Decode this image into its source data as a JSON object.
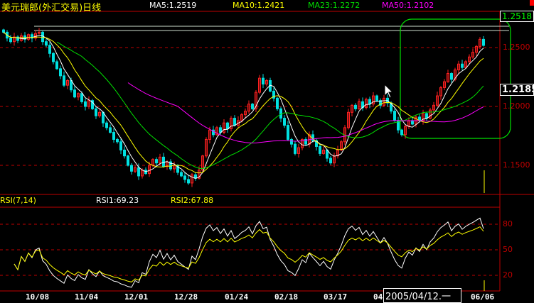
{
  "header": {
    "title": "美元瑞郎(外汇交易)日线",
    "ma5": "MA5:1.2519",
    "ma10": "MA10:1.2421",
    "ma23": "MA23:1.2272",
    "ma50": "MA50:1.2102"
  },
  "price_axis": {
    "labels": [
      "1.2500",
      "1.2000",
      "1.1500"
    ],
    "last_price": "1.2518",
    "cursor_price": "1.2185"
  },
  "rsi_panel": {
    "title": "RSI(7,14)",
    "rsi1": "RSI1:69.23",
    "rsi2": "RSI2:67.88",
    "levels": [
      "80",
      "50",
      "20"
    ]
  },
  "date_axis": {
    "labels": [
      "10/08",
      "11/04",
      "12/01",
      "12/28",
      "01/24",
      "02/18",
      "03/17",
      "04",
      "06/06"
    ],
    "cursor_date": "2005/04/12.一"
  },
  "colors": {
    "up": "#ff2020",
    "down": "#00e0e0",
    "ma5": "#ffffff",
    "ma10": "#ffff00",
    "ma23": "#00e000",
    "ma50": "#ff00ff",
    "grid": "#c00000"
  },
  "chart_data": {
    "type": "candlestick",
    "title": "美元瑞郎(外汇交易)日线",
    "ylim": [
      1.13,
      1.27
    ],
    "grid": true,
    "close": [
      1.263,
      1.258,
      1.255,
      1.259,
      1.256,
      1.26,
      1.257,
      1.261,
      1.258,
      1.262,
      1.263,
      1.255,
      1.252,
      1.245,
      1.238,
      1.232,
      1.226,
      1.218,
      1.222,
      1.214,
      1.208,
      1.211,
      1.204,
      1.2,
      1.205,
      1.198,
      1.192,
      1.195,
      1.186,
      1.182,
      1.178,
      1.172,
      1.17,
      1.163,
      1.158,
      1.15,
      1.145,
      1.148,
      1.141,
      1.146,
      1.143,
      1.15,
      1.155,
      1.152,
      1.157,
      1.149,
      1.153,
      1.147,
      1.15,
      1.144,
      1.141,
      1.138,
      1.135,
      1.142,
      1.139,
      1.146,
      1.158,
      1.172,
      1.18,
      1.176,
      1.182,
      1.178,
      1.186,
      1.181,
      1.19,
      1.184,
      1.188,
      1.193,
      1.196,
      1.202,
      1.198,
      1.212,
      1.224,
      1.219,
      1.222,
      1.213,
      1.207,
      1.198,
      1.19,
      1.184,
      1.172,
      1.168,
      1.16,
      1.165,
      1.172,
      1.168,
      1.176,
      1.171,
      1.166,
      1.16,
      1.163,
      1.156,
      1.152,
      1.158,
      1.163,
      1.17,
      1.182,
      1.195,
      1.201,
      1.198,
      1.204,
      1.199,
      1.206,
      1.202,
      1.209,
      1.205,
      1.201,
      1.207,
      1.203,
      1.196,
      1.188,
      1.18,
      1.176,
      1.183,
      1.188,
      1.185,
      1.191,
      1.188,
      1.194,
      1.19,
      1.197,
      1.201,
      1.209,
      1.216,
      1.221,
      1.228,
      1.223,
      1.231,
      1.236,
      1.233,
      1.238,
      1.242,
      1.246,
      1.251,
      1.257,
      1.2518
    ],
    "moving_averages": [
      5,
      10,
      23,
      50
    ],
    "rsi_periods": [
      7,
      14
    ],
    "rsi_ylim": [
      0,
      100
    ]
  }
}
